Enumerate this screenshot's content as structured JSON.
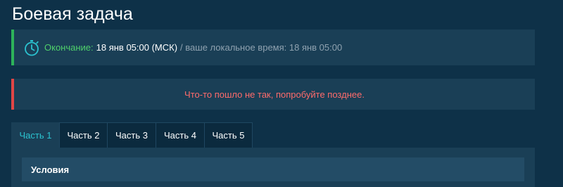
{
  "page": {
    "title": "Боевая задача"
  },
  "deadline": {
    "icon": "stopwatch-icon",
    "label": "Окончание:",
    "value": "18 янв 05:00 (МСК)",
    "local_time": "/ ваше локальное время: 18 янв 05:00",
    "accent_color": "#2db35a"
  },
  "error": {
    "message": "Что-то пошло не так, попробуйте позднее.",
    "accent_color": "#e04646"
  },
  "tabs": [
    {
      "label": "Часть 1",
      "active": true
    },
    {
      "label": "Часть 2",
      "active": false
    },
    {
      "label": "Часть 3",
      "active": false
    },
    {
      "label": "Часть 4",
      "active": false
    },
    {
      "label": "Часть 5",
      "active": false
    }
  ],
  "section": {
    "title": "Условия"
  },
  "colors": {
    "background": "#0e3148",
    "panel": "#1a3f56",
    "active_tab_text": "#2bc3d0"
  }
}
